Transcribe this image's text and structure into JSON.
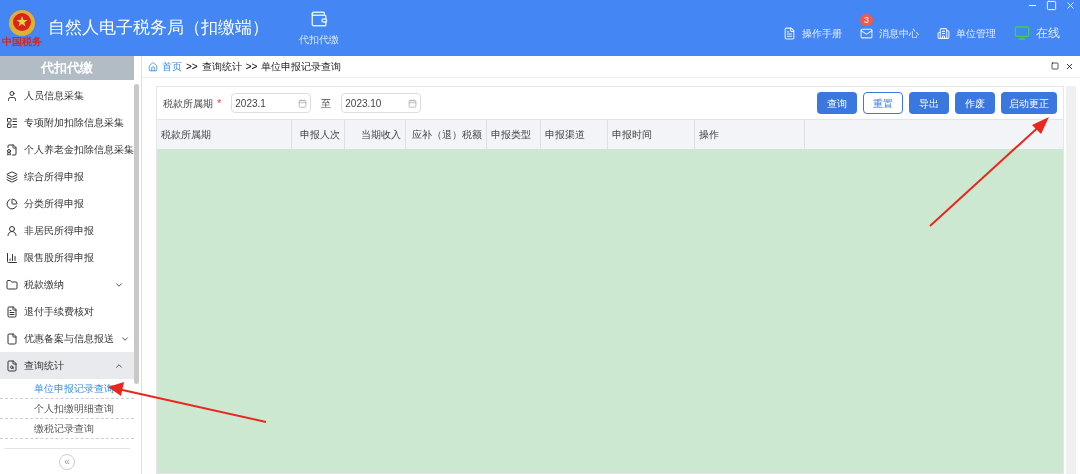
{
  "header": {
    "logo_text": "中国税务",
    "title": "自然人电子税务局（扣缴端）",
    "nav": [
      {
        "label": "代扣代缴"
      }
    ],
    "actions": [
      {
        "kind": "manual",
        "label": "操作手册"
      },
      {
        "kind": "messages",
        "label": "消息中心",
        "badge": "3"
      },
      {
        "kind": "org",
        "label": "单位管理"
      },
      {
        "kind": "online",
        "label": "在线"
      }
    ]
  },
  "sidebar": {
    "title": "代扣代缴",
    "items": [
      {
        "label": "人员信息采集",
        "selected": false
      },
      {
        "label": "专项附加扣除信息采集",
        "selected": false
      },
      {
        "label": "个人养老金扣除信息采集",
        "selected": false
      },
      {
        "label": "综合所得申报",
        "selected": false
      },
      {
        "label": "分类所得申报",
        "selected": false
      },
      {
        "label": "非居民所得申报",
        "selected": false
      },
      {
        "label": "限售股所得申报",
        "selected": false
      },
      {
        "label": "税款缴纳",
        "selected": false,
        "expanded": false
      },
      {
        "label": "退付手续费核对",
        "selected": false
      },
      {
        "label": "优惠备案与信息报送",
        "selected": false,
        "expanded": false
      },
      {
        "label": "查询统计",
        "selected": true,
        "expanded": true,
        "children": [
          {
            "label": "单位申报记录查询",
            "selected": true
          },
          {
            "label": "个人扣缴明细查询",
            "selected": false
          },
          {
            "label": "缴税记录查询",
            "selected": false
          }
        ]
      }
    ],
    "collapse": "«"
  },
  "breadcrumb": {
    "items": [
      "首页",
      "查询统计",
      "单位申报记录查询"
    ],
    "separator": ">>"
  },
  "filter": {
    "label": "税款所属期",
    "required_mark": "*",
    "from": "2023.1",
    "to_label": "至",
    "to": "2023.10"
  },
  "buttons": [
    {
      "label": "查询",
      "kind": "primary"
    },
    {
      "label": "重置",
      "kind": "outline"
    },
    {
      "label": "导出",
      "kind": "primary"
    },
    {
      "label": "作废",
      "kind": "primary"
    },
    {
      "label": "启动更正",
      "kind": "primary"
    }
  ],
  "table": {
    "columns": [
      {
        "label": "税款所属期"
      },
      {
        "label": "申报人次"
      },
      {
        "label": "当期收入"
      },
      {
        "label": "应补（退）税额"
      },
      {
        "label": "申报类型"
      },
      {
        "label": "申报渠道"
      },
      {
        "label": "申报时间"
      },
      {
        "label": "操作"
      }
    ]
  }
}
